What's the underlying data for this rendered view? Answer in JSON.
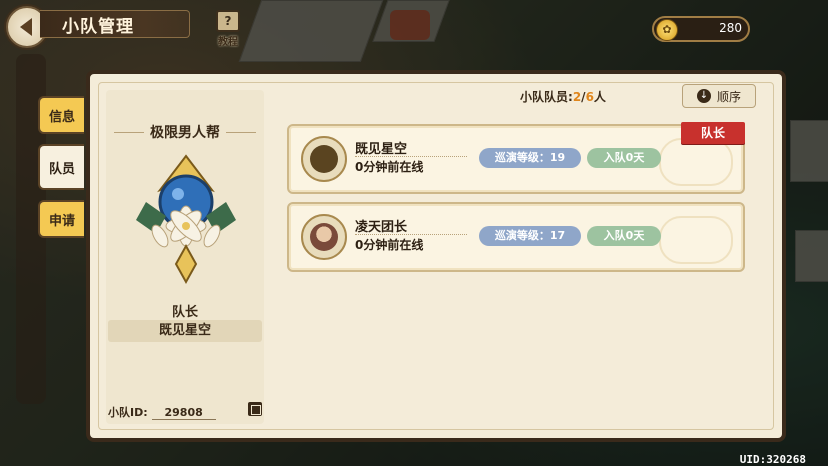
{
  "top": {
    "title": "小队管理",
    "tutorial_label": "教程",
    "tutorial_glyph": "?",
    "currency_amount": "280"
  },
  "tabs": [
    {
      "label": "信息",
      "active": false
    },
    {
      "label": "队员",
      "active": true
    },
    {
      "label": "申请",
      "active": false
    }
  ],
  "team": {
    "name": "极限男人帮",
    "leader_label": "队长",
    "leader_name": "既见星空",
    "id_label": "小队ID:",
    "id_value": "29808"
  },
  "members_header": {
    "label": "小队队员:",
    "current": "2",
    "separator": "/",
    "max": "6",
    "unit": "人",
    "sort_label": "顺序",
    "sort_glyph": "↓"
  },
  "members": [
    {
      "name": "既见星空",
      "status": "0分钟前在线",
      "level": "巡演等级：19",
      "joined": "入队0天",
      "badge": "队长",
      "avatar_color": "#5a4420"
    },
    {
      "name": "凌天团长",
      "status": "0分钟前在线",
      "level": "巡演等级：17",
      "joined": "入队0天",
      "badge": "",
      "avatar_color": "#7a4a3a"
    }
  ],
  "footer": {
    "uid": "UID:320268"
  },
  "colors": {
    "leader_badge": "#c8312d",
    "highlight": "#e0861c",
    "level_pill": "#8fa6c9",
    "joined_pill": "#9dc3a0"
  }
}
